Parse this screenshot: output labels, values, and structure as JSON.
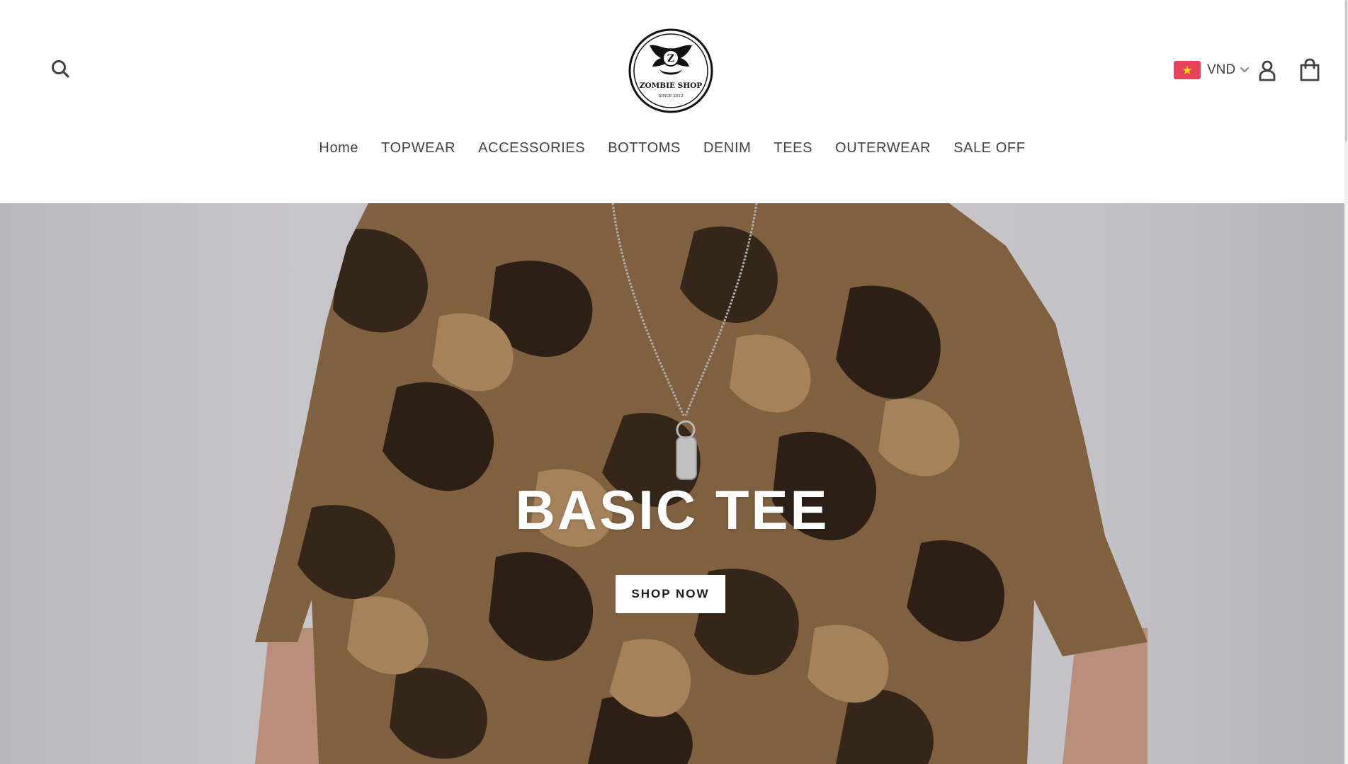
{
  "header": {
    "search_icon": "search-icon",
    "logo": {
      "icon": "zombie-shop-logo",
      "text": "ZOMBIE SHOP",
      "tagline": "SINCE 2012"
    },
    "currency": {
      "flag": "vietnam-flag-icon",
      "code": "VND",
      "dropdown_icon": "chevron-down-icon"
    },
    "account_icon": "user-icon",
    "cart_icon": "cart-icon"
  },
  "nav": {
    "items": [
      {
        "label": "Home"
      },
      {
        "label": "TOPWEAR"
      },
      {
        "label": "ACCESSORIES"
      },
      {
        "label": "BOTTOMS"
      },
      {
        "label": "DENIM"
      },
      {
        "label": "TEES"
      },
      {
        "label": "OUTERWEAR"
      },
      {
        "label": "SALE OFF"
      }
    ]
  },
  "hero": {
    "title": "BASIC TEE",
    "button_label": "SHOP NOW",
    "image_desc_icon": "camo-tee-photo"
  },
  "colors": {
    "text": "#3d4246",
    "flag_red": "#e8435a",
    "flag_star": "#ffde00",
    "hero_text": "#ffffff",
    "button_bg": "#ffffff"
  }
}
